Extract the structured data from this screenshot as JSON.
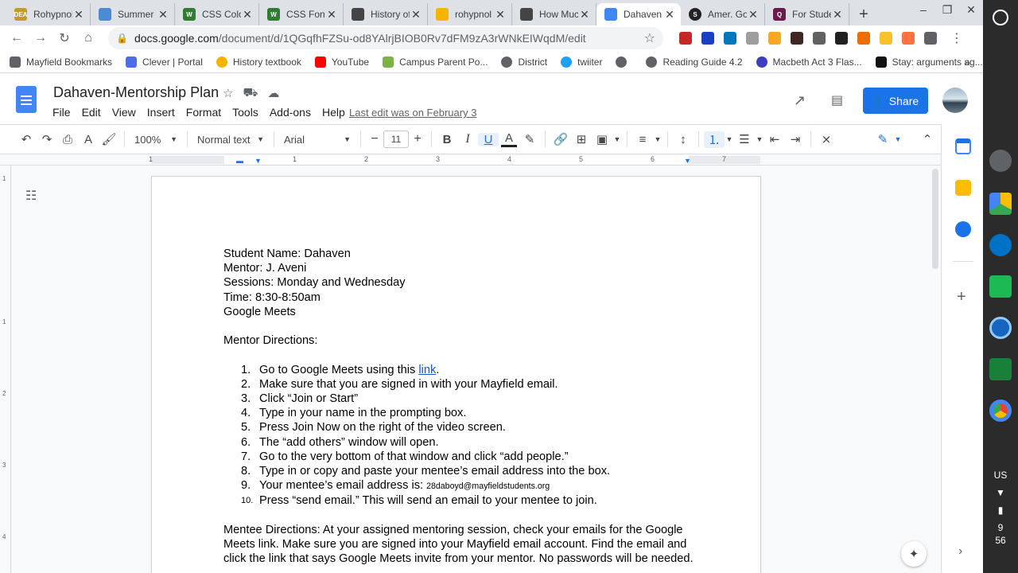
{
  "browser": {
    "tabs": [
      {
        "title": "Rohypnol",
        "color": "#c49a2c",
        "badge": "DEA"
      },
      {
        "title": "Summer",
        "color": "#4b8bd3",
        "badge": ""
      },
      {
        "title": "CSS Colors",
        "color": "#2e7d32",
        "badge": "W"
      },
      {
        "title": "CSS Fonts",
        "color": "#2e7d32",
        "badge": "W"
      },
      {
        "title": "History of",
        "color": "#444444",
        "badge": ""
      },
      {
        "title": "rohypnol",
        "color": "#f4b400",
        "badge": ""
      },
      {
        "title": "How Much",
        "color": "#444444",
        "badge": ""
      },
      {
        "title": "Dahaven",
        "color": "#4285f4",
        "badge": ""
      },
      {
        "title": "Amer. Go",
        "color": "#222222",
        "badge": "S"
      },
      {
        "title": "For Students",
        "color": "#6a1b4d",
        "badge": "Q"
      }
    ],
    "url_main": "docs.google.com",
    "url_rest": "/document/d/1QGqfhFZSu-od8YAlrjBIOB0Rv7dFM9zA3rWNkEIWqdM/edit",
    "bookmarks": [
      {
        "label": "Mayfield Bookmarks",
        "color": "#5f6368"
      },
      {
        "label": "Clever | Portal",
        "color": "#4f6ce6"
      },
      {
        "label": "History textbook",
        "color": "#f4b400"
      },
      {
        "label": "YouTube",
        "color": "#ff0000"
      },
      {
        "label": "Campus Parent Po...",
        "color": "#7cb342"
      },
      {
        "label": "District",
        "color": "#5f6368"
      },
      {
        "label": "twiiter",
        "color": "#1da1f2"
      },
      {
        "label": "",
        "color": "#5f6368"
      },
      {
        "label": "Reading Guide 4.2",
        "color": "#5f6368"
      },
      {
        "label": "Macbeth Act 3 Flas...",
        "color": "#3d3dbf"
      },
      {
        "label": "Stay: arguments ag...",
        "color": "#111111"
      }
    ],
    "bookmarks_more": "»"
  },
  "docs": {
    "title": "Dahaven-Mentorship Plan",
    "menu": [
      "File",
      "Edit",
      "View",
      "Insert",
      "Format",
      "Tools",
      "Add-ons",
      "Help"
    ],
    "last_edit": "Last edit was on February 3",
    "share_label": "Share",
    "toolbar": {
      "zoom": "100%",
      "style": "Normal text",
      "font": "Arial",
      "font_size": "11"
    }
  },
  "document": {
    "header_lines": [
      "Student Name: Dahaven",
      "Mentor: J. Aveni",
      "Sessions: Monday and Wednesday",
      "Time: 8:30-8:50am",
      "Google Meets"
    ],
    "mentor_heading": "Mentor Directions:",
    "steps": [
      {
        "n": "1.",
        "pre": "Go to Google Meets using this ",
        "link": "link",
        "post": "."
      },
      {
        "n": "2.",
        "text": "Make sure that you are signed in with your Mayfield email."
      },
      {
        "n": "3.",
        "text": "Click “Join or Start”"
      },
      {
        "n": "4.",
        "text": "Type in your name in the prompting box."
      },
      {
        "n": "5.",
        "text": "Press Join Now on the right of the video screen."
      },
      {
        "n": "6.",
        "text": "The “add others” window will open."
      },
      {
        "n": "7.",
        "text": "Go to the very bottom of that window and click “add people.”"
      },
      {
        "n": "8.",
        "text": "Type in or copy and paste your mentee’s email address into the box."
      },
      {
        "n": "9.",
        "pre": "Your mentee’s email address is: ",
        "email": "28daboyd@mayfieldstudents.org"
      },
      {
        "n": "10.",
        "text": "Press “send email.” This will send an email to your mentee to join."
      }
    ],
    "mentee_directions": "Mentee Directions: At your assigned mentoring session, check your emails for the Google Meets link. Make sure you are signed into your Mayfield email account. Find the email and click the link that says Google Meets invite from your mentor. No passwords will be needed."
  },
  "ruler": {
    "h_numbers": [
      "1",
      "1",
      "2",
      "3",
      "4",
      "5",
      "6",
      "7"
    ],
    "v_numbers": [
      "1",
      "1",
      "2",
      "3",
      "4"
    ]
  },
  "system": {
    "locale": "US",
    "clock_hour": "9",
    "clock_min": "56"
  }
}
